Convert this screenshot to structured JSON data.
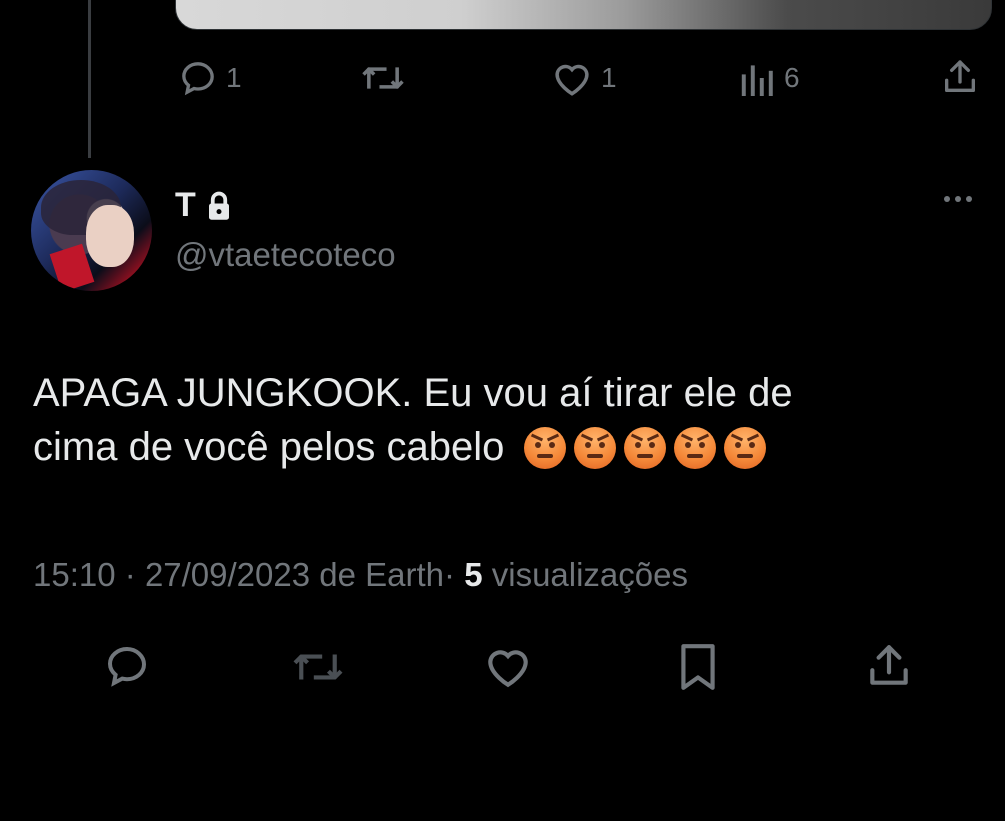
{
  "previous_tweet": {
    "actions": {
      "reply_count": "1",
      "like_count": "1",
      "view_count": "6"
    }
  },
  "tweet": {
    "author": {
      "display_name": "T",
      "handle": "@vtaetecoteco"
    },
    "text_line1": "APAGA JUNGKOOK. Eu vou aí tirar ele de",
    "text_line2": "cima de você pelos cabelo",
    "emojis": [
      "angry-face",
      "angry-face",
      "angry-face",
      "angry-face",
      "angry-face"
    ],
    "time": "15:10",
    "date": "27/09/2023",
    "source": "de Earth",
    "separator": "·",
    "views_count": "5",
    "views_label": "visualizações"
  },
  "icons": {
    "reply": "comment-icon",
    "retweet": "retweet-icon",
    "like": "heart-icon",
    "views": "analytics-icon",
    "share": "share-icon",
    "bookmark": "bookmark-icon",
    "lock": "lock-icon",
    "more": "more-icon"
  },
  "colors": {
    "background": "#000000",
    "text_primary": "#e7e9ea",
    "text_secondary": "#71767b",
    "divider": "#3a3d41"
  }
}
